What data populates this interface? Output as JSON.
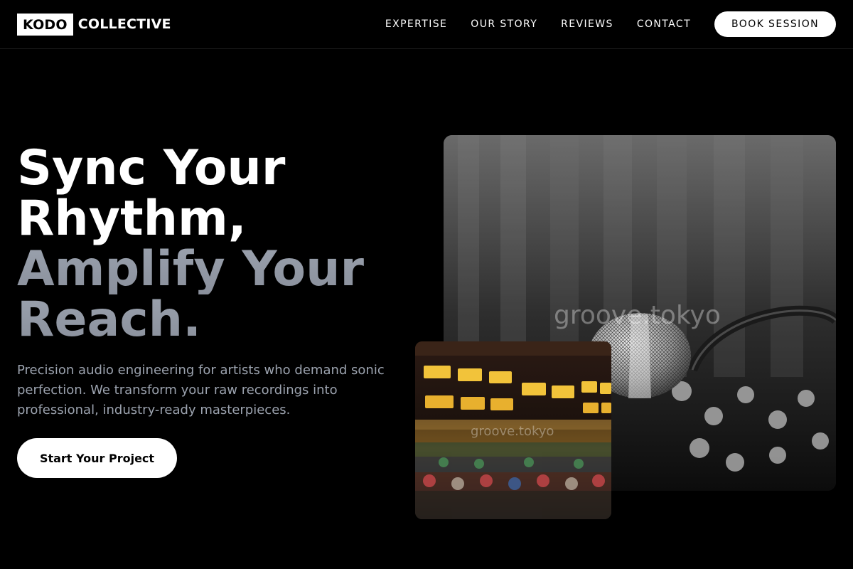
{
  "brand": {
    "box": "KODO",
    "text": "COLLECTIVE"
  },
  "nav": {
    "links": [
      "EXPERTISE",
      "OUR STORY",
      "REVIEWS",
      "CONTACT"
    ],
    "cta": "BOOK SESSION"
  },
  "hero": {
    "headline_white": [
      "Sync Your",
      "Rhythm,"
    ],
    "headline_gray": [
      "Amplify Your",
      "Reach."
    ],
    "subtext": "Precision audio engineering for artists who demand sonic perfection. We transform your raw recordings into professional, industry-ready masterpieces.",
    "cta": "Start Your Project"
  },
  "images": {
    "main": {
      "subject": "microphone over mixing console",
      "watermark": "groove.tokyo"
    },
    "small": {
      "subject": "analog mixing console with VU meters",
      "watermark": "groove.tokyo"
    }
  },
  "colors": {
    "background": "#000000",
    "accent": "#ffffff",
    "muted_text": "#9ca3af",
    "headline_gray": "#9aa1ad"
  }
}
